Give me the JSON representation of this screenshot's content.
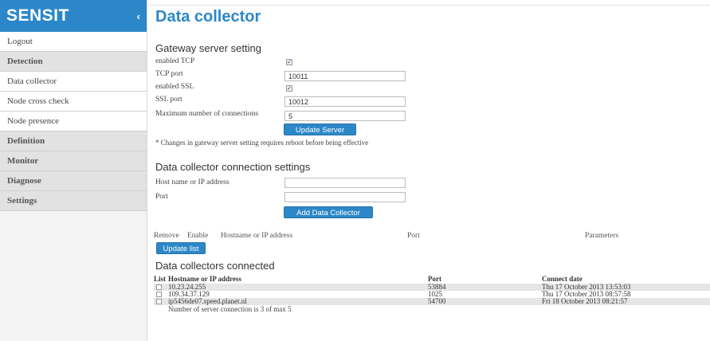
{
  "sidebar": {
    "brand": "SENSIT",
    "collapse_icon": "chevron-left-icon",
    "items": [
      {
        "label": "Logout",
        "kind": "link"
      },
      {
        "label": "Detection",
        "kind": "section"
      },
      {
        "label": "Data collector",
        "kind": "link"
      },
      {
        "label": "Node cross check",
        "kind": "link"
      },
      {
        "label": "Node presence",
        "kind": "link"
      },
      {
        "label": "Definition",
        "kind": "section"
      },
      {
        "label": "Monitor",
        "kind": "section"
      },
      {
        "label": "Diagnose",
        "kind": "section"
      },
      {
        "label": "Settings",
        "kind": "section"
      }
    ]
  },
  "page": {
    "title": "Data collector"
  },
  "gateway": {
    "heading": "Gateway server setting",
    "enabled_tcp_label": "enabled TCP",
    "enabled_tcp_checked": true,
    "tcp_port_label": "TCP port",
    "tcp_port_value": "10011",
    "enabled_ssl_label": "enabled SSL",
    "enabled_ssl_checked": true,
    "ssl_port_label": "SSL port",
    "ssl_port_value": "10012",
    "max_conn_label": "Maximum number of connections",
    "max_conn_value": "5",
    "update_button": "Update Server",
    "note": "* Changes in gateway server setting requires reboot before being effective"
  },
  "connection": {
    "heading": "Data collector connection settings",
    "host_label": "Host name or IP address",
    "host_value": "",
    "port_label": "Port",
    "port_value": "",
    "add_button": "Add Data Collector"
  },
  "list": {
    "col_remove": "Remove",
    "col_enable": "Enable",
    "col_host": "Hostname or IP address",
    "col_port": "Port",
    "col_params": "Parameters",
    "update_button": "Update list"
  },
  "connected": {
    "heading": "Data collectors connected",
    "col_list": "List",
    "col_host": "Hostname or IP address",
    "col_port": "Port",
    "col_date": "Connect date",
    "rows": [
      {
        "host": "10.23.24.255",
        "port": "53884",
        "date": "Thu 17 October 2013 13:53:03"
      },
      {
        "host": "109.34.37.129",
        "port": "1025",
        "date": "Thu 17 October 2013 08:57:58"
      },
      {
        "host": "ip5456de07.speed.planet.nl",
        "port": "54700",
        "date": "Fri 18 October 2013 08:21:57"
      }
    ],
    "footer": "Number of server connection is 3 of max 5"
  }
}
